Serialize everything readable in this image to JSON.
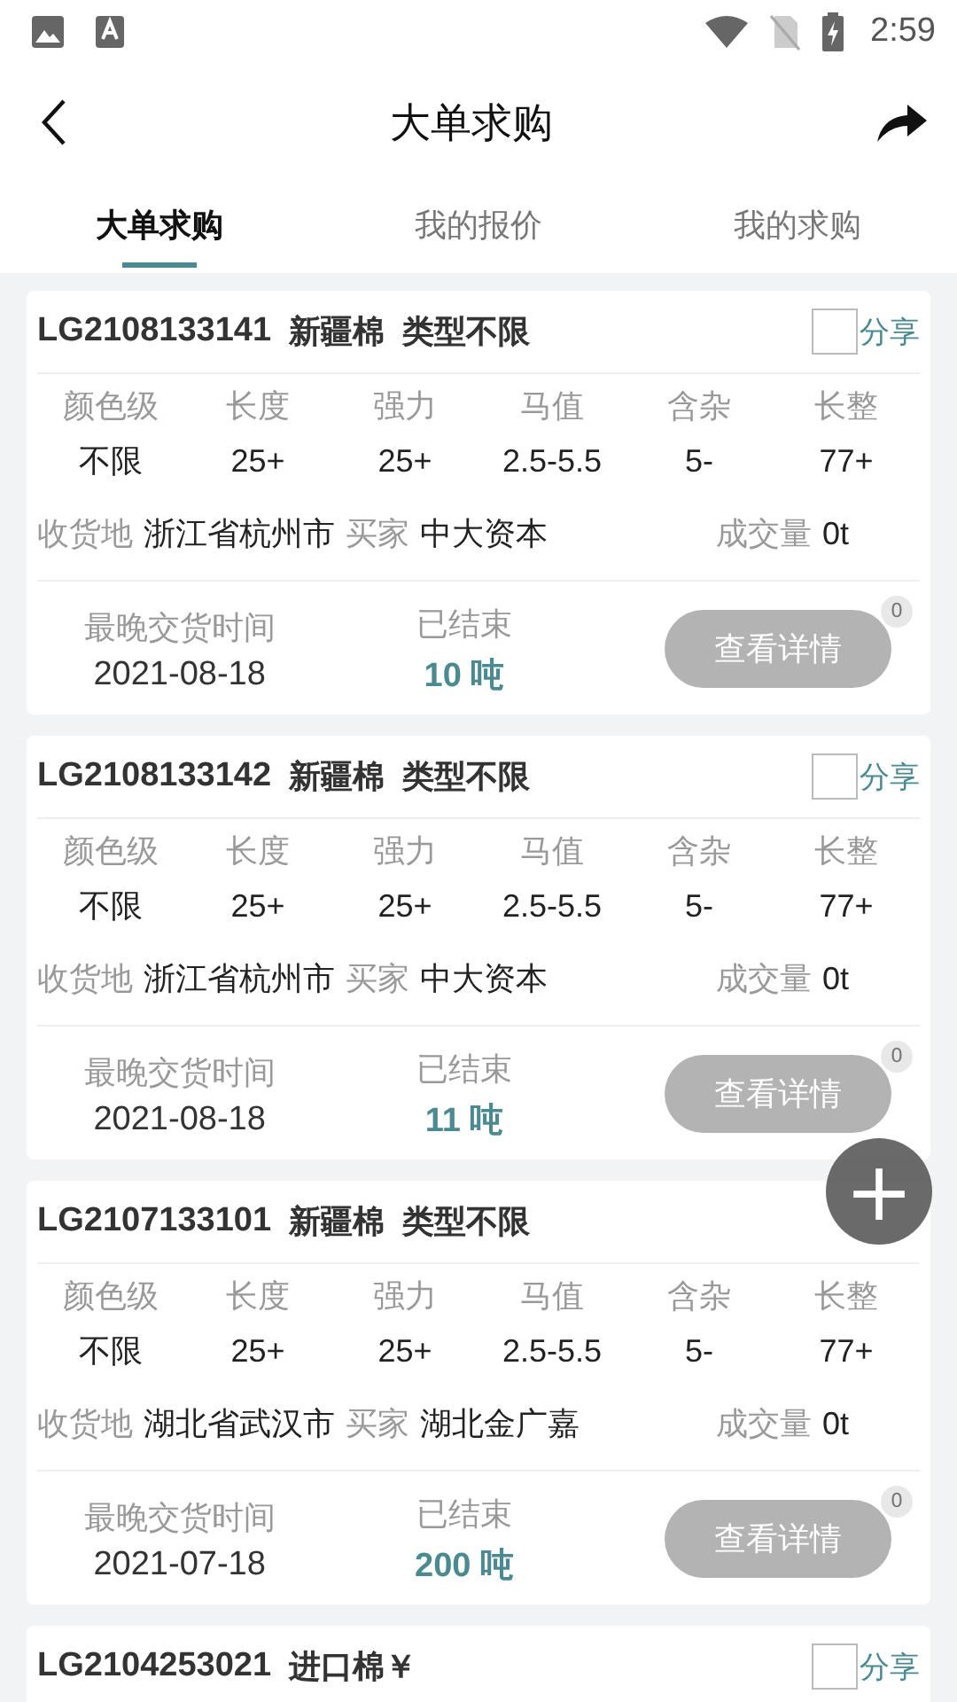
{
  "status_bar": {
    "time": "2:59"
  },
  "header": {
    "title": "大单求购"
  },
  "tabs": [
    {
      "label": "大单求购",
      "selected": true
    },
    {
      "label": "我的报价",
      "selected": false
    },
    {
      "label": "我的求购",
      "selected": false
    }
  ],
  "orders": [
    {
      "code": "LG2108133141",
      "origin": "新疆棉",
      "type": "类型不限",
      "checked": false,
      "share": "分享",
      "specs": [
        {
          "label": "颜色级",
          "value": "不限"
        },
        {
          "label": "长度",
          "value": "25+"
        },
        {
          "label": "强力",
          "value": "25+"
        },
        {
          "label": "马值",
          "value": "2.5-5.5"
        },
        {
          "label": "含杂",
          "value": "5-"
        },
        {
          "label": "长整",
          "value": "77+"
        }
      ],
      "place_label": "收货地",
      "place": "浙江省杭州市",
      "buyer_label": "买家",
      "buyer": "中大资本",
      "volume_label": "成交量",
      "volume": "0t",
      "deadline_label": "最晚交货时间",
      "deadline": "2021-08-18",
      "status": "已结束",
      "amount": "10 吨",
      "button": "查看详情",
      "badge": "0"
    },
    {
      "code": "LG2108133142",
      "origin": "新疆棉",
      "type": "类型不限",
      "checked": false,
      "share": "分享",
      "specs": [
        {
          "label": "颜色级",
          "value": "不限"
        },
        {
          "label": "长度",
          "value": "25+"
        },
        {
          "label": "强力",
          "value": "25+"
        },
        {
          "label": "马值",
          "value": "2.5-5.5"
        },
        {
          "label": "含杂",
          "value": "5-"
        },
        {
          "label": "长整",
          "value": "77+"
        }
      ],
      "place_label": "收货地",
      "place": "浙江省杭州市",
      "buyer_label": "买家",
      "buyer": "中大资本",
      "volume_label": "成交量",
      "volume": "0t",
      "deadline_label": "最晚交货时间",
      "deadline": "2021-08-18",
      "status": "已结束",
      "amount": "11 吨",
      "button": "查看详情",
      "badge": "0"
    },
    {
      "code": "LG2107133101",
      "origin": "新疆棉",
      "type": "类型不限",
      "specs": [
        {
          "label": "颜色级",
          "value": "不限"
        },
        {
          "label": "长度",
          "value": "25+"
        },
        {
          "label": "强力",
          "value": "25+"
        },
        {
          "label": "马值",
          "value": "2.5-5.5"
        },
        {
          "label": "含杂",
          "value": "5-"
        },
        {
          "label": "长整",
          "value": "77+"
        }
      ],
      "place_label": "收货地",
      "place": "湖北省武汉市",
      "buyer_label": "买家",
      "buyer": "湖北金广嘉",
      "volume_label": "成交量",
      "volume": "0t",
      "deadline_label": "最晚交货时间",
      "deadline": "2021-07-18",
      "status": "已结束",
      "amount": "200 吨",
      "button": "查看详情",
      "badge": "0"
    },
    {
      "code": "LG2104253021",
      "origin": "进口棉￥",
      "checked": false,
      "share": "分享"
    }
  ],
  "fab": {
    "symbol": "+"
  }
}
